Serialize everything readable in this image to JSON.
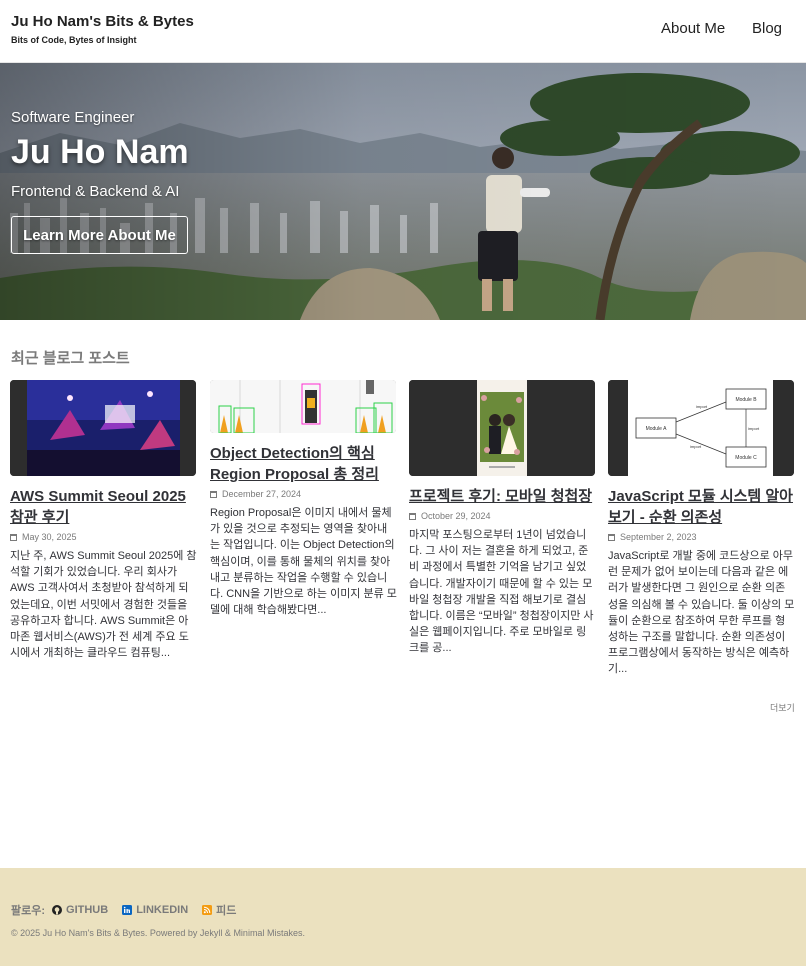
{
  "header": {
    "site_title": "Ju Ho Nam's Bits & Bytes",
    "site_subtitle": "Bits of Code, Bytes of Insight",
    "nav": [
      {
        "label": "About Me"
      },
      {
        "label": "Blog"
      }
    ]
  },
  "hero": {
    "overline": "Software Engineer",
    "title": "Ju Ho Nam",
    "tagline": "Frontend & Backend & AI",
    "button_label": "Learn More About Me"
  },
  "recent": {
    "section_title": "최근 블로그 포스트",
    "posts": [
      {
        "title": "AWS Summit Seoul 2025 참관 후기",
        "date": "May 30, 2025",
        "excerpt": "지난 주, AWS Summit Seoul 2025에 참석할 기회가 있었습니다. 우리 회사가 AWS 고객사여서 초청받아 참석하게 되었는데요, 이번 서밋에서 경험한 것들을 공유하고자 합니다. AWS Summit은 아마존 웹서비스(AWS)가 전 세계 주요 도시에서 개최하는 클라우드 컴퓨팅..."
      },
      {
        "title": "Object Detection의 핵심 Region Proposal 총 정리",
        "date": "December 27, 2024",
        "excerpt": "Region Proposal은 이미지 내에서 물체가 있을 것으로 추정되는 영역을 찾아내는 작업입니다. 이는 Object Detection의 핵심이며, 이를 통해 물체의 위치를 찾아내고 분류하는 작업을 수행할 수 있습니다. CNN을 기반으로 하는 이미지 분류 모델에 대해 학습해봤다면..."
      },
      {
        "title": "프로젝트 후기: 모바일 청첩장",
        "date": "October 29, 2024",
        "excerpt": "마지막 포스팅으로부터 1년이 넘었습니다. 그 사이 저는 결혼을 하게 되었고, 준비 과정에서 특별한 기억을 남기고 싶었습니다. 개발자이기 때문에 할 수 있는 모바일 청첩장 개발을 직접 해보기로 결심합니다. 이름은 “모바일” 청첩장이지만 사실은 웹페이지입니다. 주로 모바일로 링크를 공..."
      },
      {
        "title": "JavaScript 모듈 시스템 알아보기 - 순환 의존성",
        "date": "September 2, 2023",
        "excerpt": "JavaScript로 개발 중에 코드상으로 아무런 문제가 없어 보이는데 다음과 같은 에러가 발생한다면 그 원인으로 순환 의존성을 의심해 볼 수 있습니다. 둘 이상의 모듈이 순환으로 참조하여 무한 루프를 형성하는 구조를 말합니다. 순환 의존성이 프로그램상에서 동작하는 방식은 예측하기..."
      }
    ],
    "more_label": "더보기"
  },
  "diagram_labels": {
    "module_a": "Module A",
    "module_b": "Module B",
    "module_c": "Module C",
    "import": "import"
  },
  "footer": {
    "follow_label": "팔로우:",
    "links": [
      {
        "label": "GITHUB",
        "icon": "github-icon"
      },
      {
        "label": "LINKEDIN",
        "icon": "linkedin-icon"
      },
      {
        "label": "피드",
        "icon": "rss-icon"
      }
    ],
    "copyright": "© 2025 Ju Ho Nam's Bits & Bytes. Powered by Jekyll & Minimal Mistakes."
  },
  "colors": {
    "footer_bg": "#ebe1bf",
    "text": "#313237",
    "muted": "#7a7a7a"
  }
}
